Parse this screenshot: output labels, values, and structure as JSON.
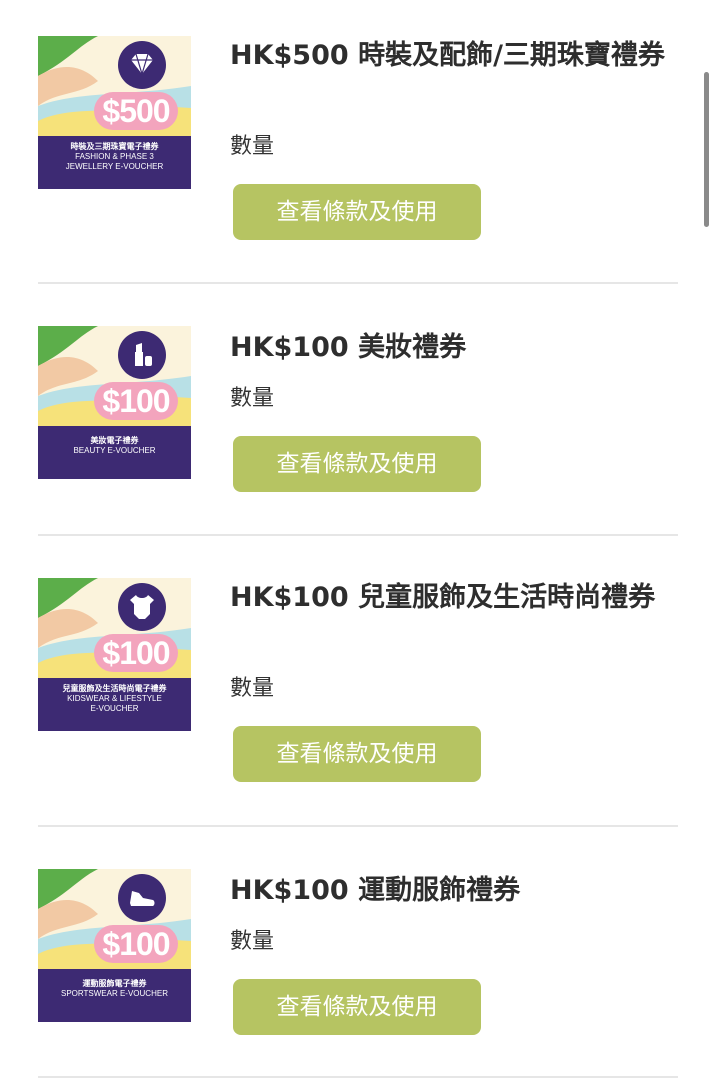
{
  "colors": {
    "button_bg": "#b6c462",
    "card_band": "#3d2a73",
    "amount_pill": "#f3a4bd"
  },
  "items": [
    {
      "title": "HK$500 時裝及配飾/三期珠寶禮券",
      "quantity_label": "數量",
      "button_label": "查看條款及使用",
      "thumbnail": {
        "amount": "$500",
        "zh": "時裝及三期珠寶電子禮券",
        "en1": "FASHION & PHASE 3",
        "en2": "JEWELLERY E-VOUCHER",
        "icon": "diamond-shoe-icon"
      }
    },
    {
      "title": "HK$100 美妝禮券",
      "quantity_label": "數量",
      "button_label": "查看條款及使用",
      "thumbnail": {
        "amount": "$100",
        "zh": "美妝電子禮券",
        "en1": "BEAUTY E-VOUCHER",
        "en2": "",
        "icon": "lipstick-icon"
      }
    },
    {
      "title": "HK$100 兒童服飾及生活時尚禮券",
      "quantity_label": "數量",
      "button_label": "查看條款及使用",
      "thumbnail": {
        "amount": "$100",
        "zh": "兒童服飾及生活時尚電子禮券",
        "en1": "KIDSWEAR & LIFESTYLE",
        "en2": "E-VOUCHER",
        "icon": "baby-onesie-icon"
      }
    },
    {
      "title": "HK$100 運動服飾禮券",
      "quantity_label": "數量",
      "button_label": "查看條款及使用",
      "thumbnail": {
        "amount": "$100",
        "zh": "運動服飾電子禮券",
        "en1": "SPORTSWEAR E-VOUCHER",
        "en2": "",
        "icon": "sneaker-icon"
      }
    }
  ]
}
